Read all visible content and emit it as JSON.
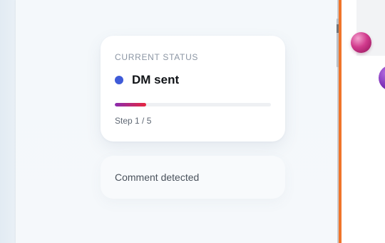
{
  "status_card": {
    "label": "CURRENT STATUS",
    "value": "DM sent",
    "dot_color": "#3f5bd8",
    "progress_fraction": 0.2,
    "step_text": "Step 1 / 5"
  },
  "comment_card": {
    "text": "Comment detected"
  },
  "colors": {
    "accent_orange": "#f0742a",
    "progress_start": "#8a2bb0",
    "progress_end": "#e7253f"
  }
}
